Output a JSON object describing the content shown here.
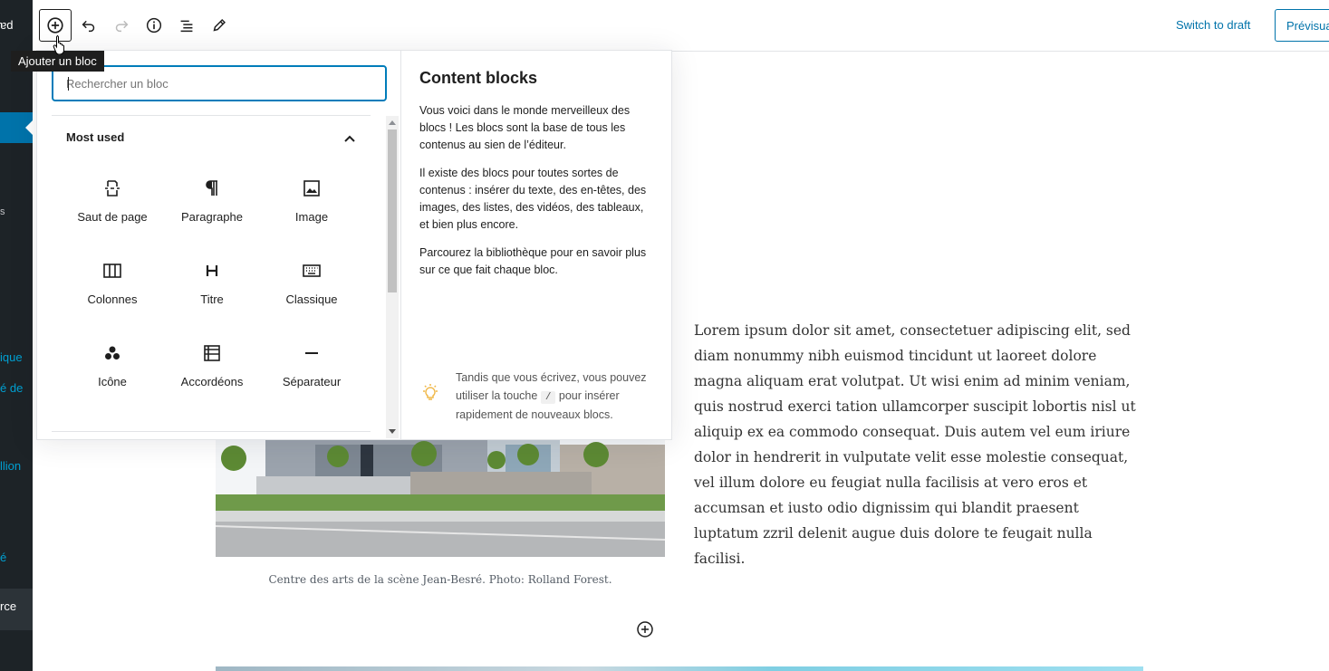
{
  "admin_sidebar": {
    "fragments": [
      "ɐd",
      "s",
      "ique",
      "é de",
      "llion",
      "é",
      "rce"
    ]
  },
  "toolbar": {
    "inserter_tooltip": "Ajouter un bloc",
    "switch_to_draft": "Switch to draft",
    "preview": "Prévisualiser"
  },
  "inserter": {
    "search_placeholder": "Rechercher un bloc",
    "panel_title": "Most used",
    "blocks": [
      {
        "label": "Saut de page",
        "icon": "page-break-icon"
      },
      {
        "label": "Paragraphe",
        "icon": "paragraph-icon"
      },
      {
        "label": "Image",
        "icon": "image-icon"
      },
      {
        "label": "Colonnes",
        "icon": "columns-icon"
      },
      {
        "label": "Titre",
        "icon": "heading-icon"
      },
      {
        "label": "Classique",
        "icon": "keyboard-icon"
      },
      {
        "label": "Icône",
        "icon": "icon-block-icon"
      },
      {
        "label": "Accordéons",
        "icon": "accordion-icon"
      },
      {
        "label": "Séparateur",
        "icon": "separator-icon"
      }
    ],
    "info": {
      "title": "Content blocks",
      "p1": "Vous voici dans le monde merveilleux des blocs ! Les blocs sont la base de tous les contenus au sien de l’éditeur.",
      "p2": "Il existe des blocs pour toutes sortes de contenus : insérer du texte, des en-têtes, des images, des listes, des vidéos, des tableaux, et bien plus encore.",
      "p3": "Parcourez la bibliothèque pour en savoir plus sur ce que fait chaque bloc.",
      "tip_before": "Tandis que vous écrivez, vous pouvez utiliser la touche",
      "tip_key": "/",
      "tip_after": "pour insérer rapidement de nouveaux blocs."
    }
  },
  "editor": {
    "paragraph": "Lorem ipsum dolor sit amet, consectetuer adipiscing elit, sed diam nonummy nibh euismod tincidunt ut laoreet dolore magna aliquam erat volutpat. Ut wisi enim ad minim veniam, quis nostrud exerci tation ullamcorper suscipit lobortis nisl ut aliquip ex ea commodo consequat. Duis autem vel eum iriure dolor in hendrerit in vulputate velit esse molestie consequat, vel illum dolore eu feugiat nulla facilisis at vero eros et accumsan et iusto odio dignissim qui blandit praesent luptatum zzril delenit augue duis dolore te feugait nulla facilisi.",
    "caption": "Centre des arts de la scène Jean-Besré. Photo: Rolland Forest."
  },
  "colors": {
    "accent": "#007cba",
    "link": "#0073aa",
    "admin_bg": "#1d2327"
  }
}
